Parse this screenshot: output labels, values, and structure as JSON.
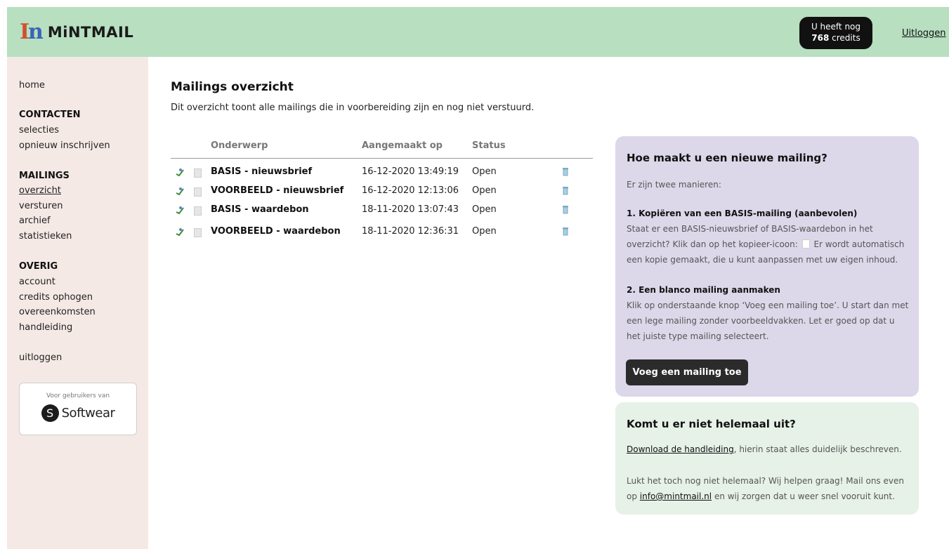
{
  "header": {
    "logo_mark_1": "I",
    "logo_mark_2": "n",
    "logo_text": "MiNTMAIL",
    "credits_line1": "U heeft nog",
    "credits_count": "768",
    "credits_unit": "credits",
    "logout": "Uitloggen",
    "background": "#b7dfc0"
  },
  "sidebar": {
    "home": "home",
    "contacten_head": "CONTACTEN",
    "selecties": "selecties",
    "opnieuw": "opnieuw inschrijven",
    "mailings_head": "MAILINGS",
    "overzicht": "overzicht",
    "versturen": "versturen",
    "archief": "archief",
    "statistieken": "statistieken",
    "overig_head": "OVERIG",
    "account": "account",
    "credits_ophogen": "credits ophogen",
    "overeenkomsten": "overeenkomsten",
    "handleiding": "handleiding",
    "uitloggen": "uitloggen",
    "partner_label": "Voor gebruikers van",
    "partner_logo_letter": "S",
    "partner_name": "Softwear",
    "background": "#f5e9e6"
  },
  "main": {
    "title": "Mailings overzicht",
    "description": "Dit overzicht toont alle mailings die in voorbereiding zijn en nog niet verstuurd.",
    "columns": {
      "subject": "Onderwerp",
      "created": "Aangemaakt op",
      "status": "Status"
    },
    "rows": [
      {
        "subject": "BASIS - nieuwsbrief",
        "created": "16-12-2020 13:49:19",
        "status": "Open"
      },
      {
        "subject": "VOORBEELD - nieuwsbrief",
        "created": "16-12-2020 12:13:06",
        "status": "Open"
      },
      {
        "subject": "BASIS - waardebon",
        "created": "18-11-2020 13:07:43",
        "status": "Open"
      },
      {
        "subject": "VOORBEELD - waardebon",
        "created": "18-11-2020 12:36:31",
        "status": "Open"
      }
    ],
    "row_icons": [
      "send-icon",
      "copy-icon",
      "trash-icon"
    ]
  },
  "help_box": {
    "title": "Hoe maakt u een nieuwe mailing?",
    "intro": "Er zijn twee manieren:",
    "step1_title": "1. Kopiëren van een BASIS-mailing (aanbevolen)",
    "step1_text_a": "Staat er een BASIS-nieuwsbrief of BASIS-waardebon in het overzicht? Klik dan op het kopieer-icoon:",
    "step1_text_b": "Er wordt automatisch een kopie gemaakt, die u kunt aanpassen met uw eigen inhoud.",
    "step2_title": "2. Een blanco mailing aanmaken",
    "step2_text": "Klik op onderstaande knop ‘Voeg een mailing toe’. U start dan met een lege mailing zonder voorbeeldvakken. Let er goed op dat u het juiste type mailing selecteert.",
    "button": "Voeg een mailing toe",
    "background": "#dcd8ea"
  },
  "support_box": {
    "title": "Komt u er niet helemaal uit?",
    "download_link": "Download de handleiding",
    "download_rest": ", hierin staat alles duidelijk beschreven.",
    "mail_text_a": "Lukt het toch nog niet helemaal? Wij helpen graag! Mail ons even op",
    "mail_link": "info@mintmail.nl",
    "mail_text_b": "en wij zorgen dat u weer snel vooruit kunt.",
    "background": "#e6f1e7"
  }
}
